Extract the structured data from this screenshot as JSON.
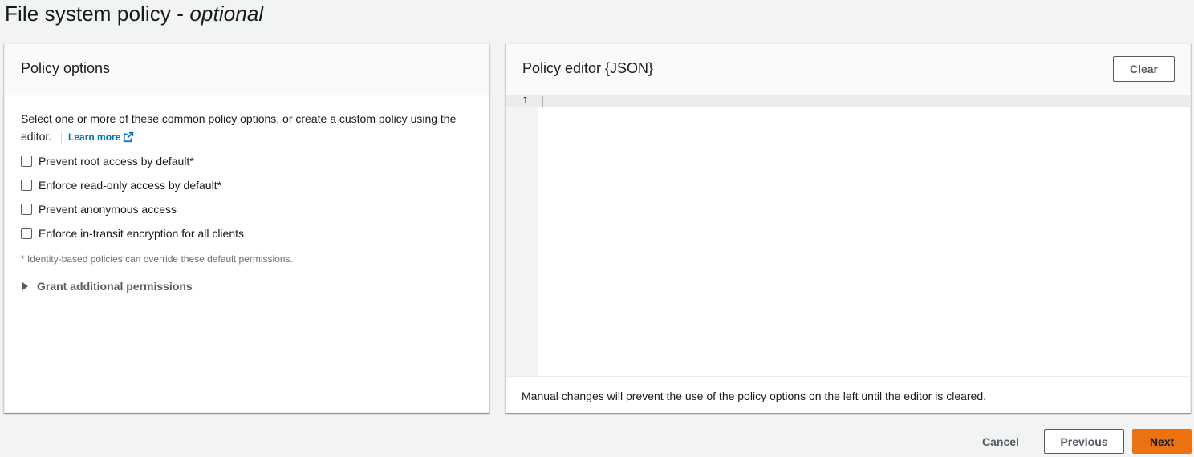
{
  "page": {
    "title": "File system policy - ",
    "title_emphasis": "optional"
  },
  "policy_options": {
    "heading": "Policy options",
    "description": "Select one or more of these common policy options, or create a custom policy using the editor.",
    "learn_more": "Learn more",
    "options": [
      {
        "label": "Prevent root access by default*",
        "checked": false
      },
      {
        "label": "Enforce read-only access by default*",
        "checked": false
      },
      {
        "label": "Prevent anonymous access",
        "checked": false
      },
      {
        "label": "Enforce in-transit encryption for all clients",
        "checked": false
      }
    ],
    "footnote": "* Identity-based policies can override these default permissions.",
    "expander": "Grant additional permissions"
  },
  "policy_editor": {
    "heading": "Policy editor {JSON}",
    "clear_label": "Clear",
    "line_number": "1",
    "content": "",
    "footer": "Manual changes will prevent the use of the policy options on the left until the editor is cleared."
  },
  "actions": {
    "cancel": "Cancel",
    "previous": "Previous",
    "next": "Next"
  },
  "colors": {
    "primary": "#ec7211",
    "link": "#0073bb",
    "background": "#f2f3f3"
  }
}
